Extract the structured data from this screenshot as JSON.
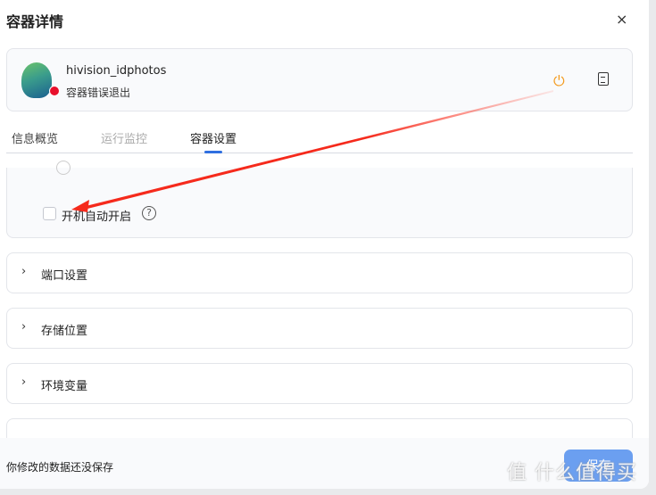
{
  "dialog": {
    "title": "容器详情",
    "close_icon": "×"
  },
  "container": {
    "name": "hivision_idphotos",
    "status": "容器错误退出",
    "status_color": "#e8102c"
  },
  "tabs": [
    {
      "label": "信息概览"
    },
    {
      "label": "运行监控"
    },
    {
      "label": "容器设置"
    }
  ],
  "settings": {
    "autostart_label": "开机自动开启",
    "autostart_checked": false,
    "help": "?"
  },
  "sections": [
    {
      "label": "端口设置"
    },
    {
      "label": "存储位置"
    },
    {
      "label": "环境变量"
    }
  ],
  "footer": {
    "message": "你修改的数据还没保存",
    "save_label": "保存"
  },
  "watermark": "值 什么值得买"
}
